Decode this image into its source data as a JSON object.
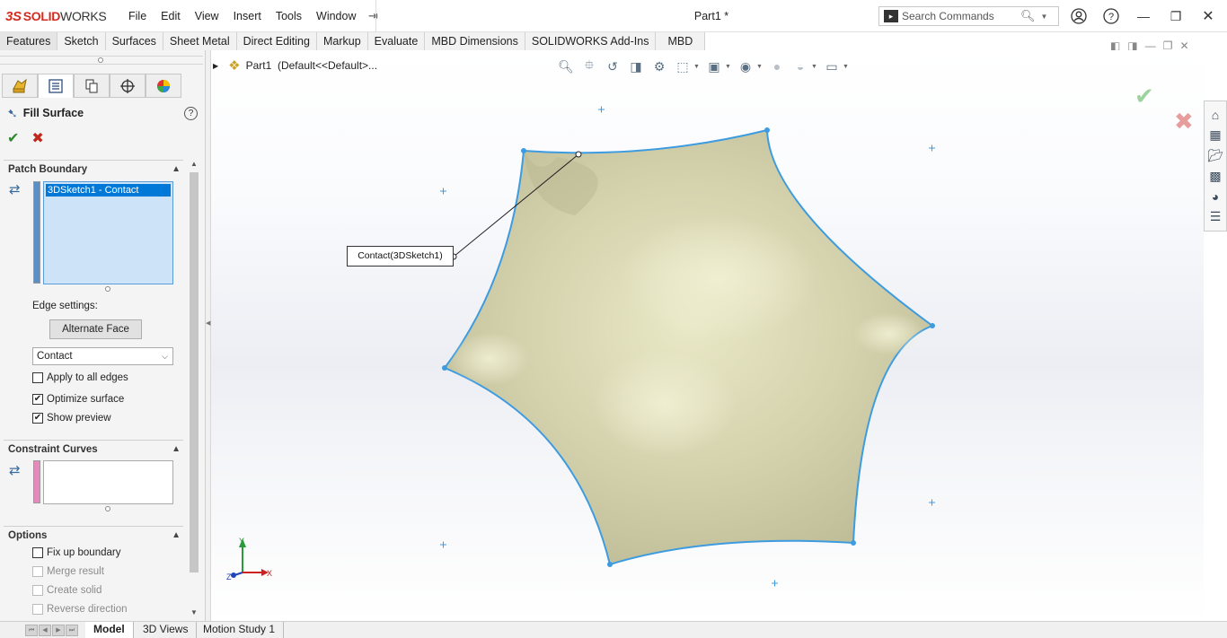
{
  "app": {
    "title": "SOLIDWORKS",
    "logo_ds": "3S",
    "logo_solid": "SOLID",
    "logo_works": "WORKS",
    "document_title": "Part1 *"
  },
  "menu": [
    "File",
    "Edit",
    "View",
    "Insert",
    "Tools",
    "Window"
  ],
  "search": {
    "placeholder": "Search Commands"
  },
  "command_tabs": [
    "Features",
    "Sketch",
    "Surfaces",
    "Sheet Metal",
    "Direct Editing",
    "Markup",
    "Evaluate",
    "MBD Dimensions",
    "SOLIDWORKS Add-Ins",
    "MBD"
  ],
  "panel": {
    "feature_title": "Fill Surface",
    "patch_boundary": {
      "header": "Patch Boundary",
      "items": [
        "3DSketch1 - Contact"
      ]
    },
    "edge_settings": {
      "label": "Edge settings:",
      "alternate_face_button": "Alternate Face",
      "selected_value": "Contact"
    },
    "checkboxes": [
      {
        "label": "Apply to all edges",
        "checked": false
      },
      {
        "label": "Optimize surface",
        "checked": true
      },
      {
        "label": "Show preview",
        "checked": true
      }
    ],
    "constraint_curves": {
      "header": "Constraint Curves"
    },
    "options": {
      "header": "Options",
      "checkboxes": [
        {
          "label": "Fix up boundary",
          "checked": false,
          "enabled": true
        },
        {
          "label": "Merge result",
          "checked": false,
          "enabled": false
        },
        {
          "label": "Create solid",
          "checked": false,
          "enabled": false
        },
        {
          "label": "Reverse direction",
          "checked": false,
          "enabled": false
        }
      ]
    }
  },
  "tree": {
    "root": "Part1",
    "config": "(Default<<Default>..."
  },
  "viewport": {
    "callout": "Contact(3DSketch1)",
    "triad": {
      "x": "X",
      "y": "Y",
      "z": "Z"
    }
  },
  "colors": {
    "surface": "#d7d5b2",
    "edge": "#3d9be0",
    "accent": "#0078d7",
    "ok": "#2d8a2d",
    "cancel": "#c0281c"
  },
  "bottom_tabs": [
    "Model",
    "3D Views",
    "Motion Study 1"
  ],
  "icons": {
    "right_rail": [
      "home-icon",
      "parts-icon",
      "folder-icon",
      "view-palette-icon",
      "appearance-icon",
      "custom-properties-icon"
    ],
    "heads_up": [
      "zoom-to-fit-icon",
      "zoom-area-icon",
      "previous-view-icon",
      "section-view-icon",
      "dynamic-annotation-icon",
      "view-orientation-icon",
      "display-style-icon",
      "hide-show-icon",
      "edit-appearance-icon",
      "apply-scene-icon",
      "view-settings-icon"
    ]
  }
}
